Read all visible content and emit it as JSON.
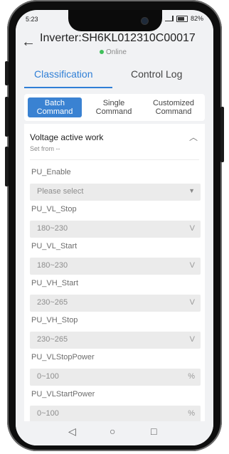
{
  "status_bar": {
    "time": "5:23",
    "battery": "82%"
  },
  "header": {
    "back_icon": "arrow-left-icon",
    "title": "Inverter:SH6KL012310C00017",
    "status": "Online",
    "status_color": "#3fbf5a"
  },
  "tabs": [
    {
      "label": "Classification",
      "active": true
    },
    {
      "label": "Control Log",
      "active": false
    }
  ],
  "command_types": [
    {
      "label": "Batch Command",
      "active": true
    },
    {
      "label": "Single Command",
      "active": false
    },
    {
      "label": "Customized Command",
      "active": false
    }
  ],
  "section": {
    "title": "Voltage active work",
    "subtitle": "Set from --",
    "collapse_icon": "chevron-up-icon"
  },
  "fields": [
    {
      "label": "PU_Enable",
      "placeholder": "Please select",
      "unit": "",
      "type": "select"
    },
    {
      "label": "PU_VL_Stop",
      "placeholder": "180~230",
      "unit": "V",
      "type": "input"
    },
    {
      "label": "PU_VL_Start",
      "placeholder": "180~230",
      "unit": "V",
      "type": "input"
    },
    {
      "label": "PU_VH_Start",
      "placeholder": "230~265",
      "unit": "V",
      "type": "input"
    },
    {
      "label": "PU_VH_Stop",
      "placeholder": "230~265",
      "unit": "V",
      "type": "input"
    },
    {
      "label": "PU_VLStopPower",
      "placeholder": "0~100",
      "unit": "%",
      "type": "input"
    },
    {
      "label": "PU_VLStartPower",
      "placeholder": "0~100",
      "unit": "%",
      "type": "input"
    }
  ],
  "nav_bar": {
    "back": "◁",
    "home": "○",
    "recent": "□"
  },
  "colors": {
    "accent": "#2f7fd6",
    "segment_active": "#3a82d2"
  }
}
